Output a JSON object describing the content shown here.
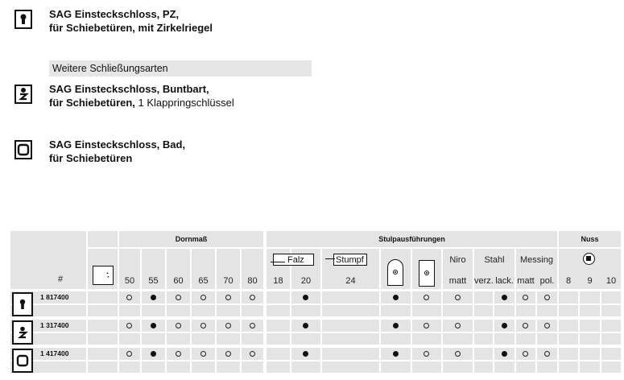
{
  "items": [
    {
      "line1": "SAG Einsteckschloss, PZ,",
      "line2": "für Schiebetüren, mit Zirkelriegel",
      "line2_extra": "",
      "icon": "cylinder-lock-icon"
    },
    {
      "line1": "SAG Einsteckschloss, Buntbart,",
      "line2": "für Schiebetüren,",
      "line2_extra": " 1 Klappringschlüssel",
      "icon": "warded-lock-icon"
    },
    {
      "line1": "SAG Einsteckschloss, Bad,",
      "line2": "für Schiebetüren",
      "line2_extra": "",
      "icon": "bathroom-lock-icon"
    }
  ],
  "band_label": "Weitere Schließungsarten",
  "table": {
    "hash_label": "#",
    "groups": {
      "dornmass": "Dornmaß",
      "stulp": "Stulpausführungen",
      "nuss": "Nuss"
    },
    "dornmass_values": [
      "50",
      "55",
      "60",
      "65",
      "70",
      "80"
    ],
    "stulp_sizes": [
      "18",
      "20",
      "24"
    ],
    "falz_label": "Falz",
    "stumpf_label": "Stumpf",
    "materials": {
      "niro": "Niro",
      "stahl": "Stahl",
      "messing": "Messing"
    },
    "finishes": {
      "niro_matt": "matt",
      "stahl_verz": "verz.",
      "stahl_lack": "lack.",
      "messing_matt": "matt",
      "messing_pol": "pol."
    },
    "nuss_values": [
      "8",
      "9",
      "10"
    ],
    "rows": [
      {
        "article": "1 817400",
        "icon": "cylinder-lock-icon",
        "dorn": [
          "empty",
          "filled",
          "empty",
          "empty",
          "empty",
          "empty"
        ],
        "stulp": [
          "filled"
        ],
        "shape": [
          "filled",
          "empty"
        ],
        "finish": [
          "empty",
          "filled",
          "empty",
          "empty"
        ]
      },
      {
        "article": "1 317400",
        "icon": "warded-lock-icon",
        "dorn": [
          "empty",
          "filled",
          "empty",
          "empty",
          "empty",
          "empty"
        ],
        "stulp": [
          "filled"
        ],
        "shape": [
          "filled",
          "empty"
        ],
        "finish": [
          "empty",
          "filled",
          "empty",
          "empty"
        ]
      },
      {
        "article": "1 417400",
        "icon": "bathroom-lock-icon",
        "dorn": [
          "empty",
          "filled",
          "empty",
          "empty",
          "empty",
          "empty"
        ],
        "stulp": [
          "filled"
        ],
        "shape": [
          "filled",
          "empty"
        ],
        "finish": [
          "empty",
          "filled",
          "empty",
          "empty"
        ]
      }
    ]
  }
}
